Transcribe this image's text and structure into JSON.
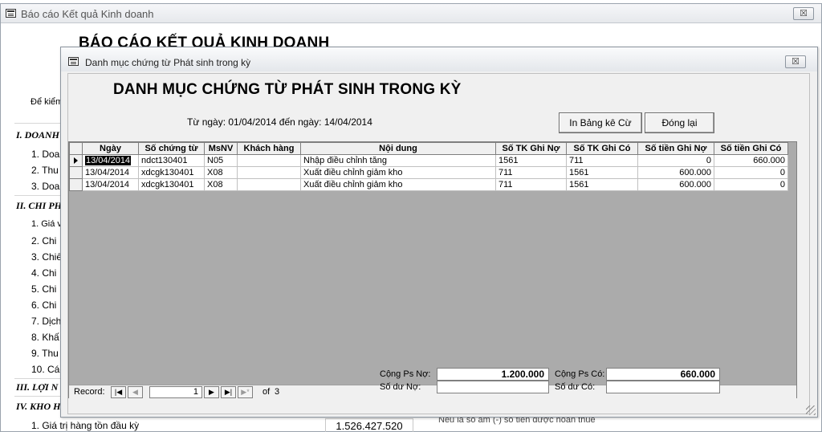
{
  "background_window": {
    "title": "Báo cáo Kết quả Kinh doanh",
    "close_glyph": "☒",
    "report_title": "BÁO CÁO KẾT QUẢ KINH DOANH",
    "de_kiem": "Để kiểm",
    "sections": [
      {
        "label": "I. DOANH"
      },
      {
        "label": "II. CHI PH"
      },
      {
        "label": "III. LỢI N"
      },
      {
        "label": "IV. KHO H"
      }
    ],
    "items": [
      "1. Doa",
      "2. Thu",
      "3. Doa",
      "1. Giá v",
      "2. Chi",
      "3. Chiế",
      "4. Chi",
      "5. Chi",
      "6. Chi",
      "7. Dịch",
      "8. Khấ",
      "9. Thu",
      "10. Các"
    ],
    "bottom_item": "1. Giá trị hàng tồn đầu kỳ",
    "bottom_value": "1.526.427.520",
    "bottom_note": "Nếu là số âm (-) số tiền được hoàn thuế"
  },
  "dialog": {
    "title": "Danh mục chứng từ Phát sinh trong kỳ",
    "close_glyph": "☒",
    "heading": "DANH MỤC CHỨNG TỪ PHÁT SINH TRONG KỲ",
    "date_range": "Từ ngày: 01/04/2014 đến ngày: 14/04/2014",
    "buttons": {
      "print": "In Bảng kê Cừ",
      "close": "Đóng lại"
    },
    "grid": {
      "columns": [
        "Ngày",
        "Số chứng từ",
        "MsNV",
        "Khách hàng",
        "Nội dung",
        "Số TK Ghi Nợ",
        "Số TK Ghi Có",
        "Số tiền Ghi Nợ",
        "Số tiền Ghi Có"
      ],
      "rows": [
        {
          "ngay": "13/04/2014",
          "so_ct": "ndct130401",
          "msnv": "N05",
          "khach_hang": "",
          "noi_dung": "Nhập điều chỉnh tăng",
          "tk_no": "1561",
          "tk_co": "711",
          "tien_no": "0",
          "tien_co": "660.000"
        },
        {
          "ngay": "13/04/2014",
          "so_ct": "xdcgk130401",
          "msnv": "X08",
          "khach_hang": "",
          "noi_dung": "Xuất điều chỉnh giảm kho",
          "tk_no": "711",
          "tk_co": "1561",
          "tien_no": "600.000",
          "tien_co": "0"
        },
        {
          "ngay": "13/04/2014",
          "so_ct": "xdcgk130401",
          "msnv": "X08",
          "khach_hang": "",
          "noi_dung": "Xuất điều chỉnh giảm kho",
          "tk_no": "711",
          "tk_co": "1561",
          "tien_no": "600.000",
          "tien_co": "0"
        }
      ]
    },
    "navigation": {
      "label": "Record:",
      "first": "|◀",
      "prev": "◀",
      "current": "1",
      "next": "▶",
      "last": "▶|",
      "new": "▶*",
      "of_label": "of",
      "total": "3"
    },
    "totals": {
      "cong_ps_no_label": "Cộng Ps Nợ:",
      "cong_ps_no_value": "1.200.000",
      "so_du_no_label": "Số dư Nợ:",
      "so_du_no_value": "",
      "cong_ps_co_label": "Cộng Ps Có:",
      "cong_ps_co_value": "660.000",
      "so_du_co_label": "Số dư Có:",
      "so_du_co_value": ""
    }
  }
}
